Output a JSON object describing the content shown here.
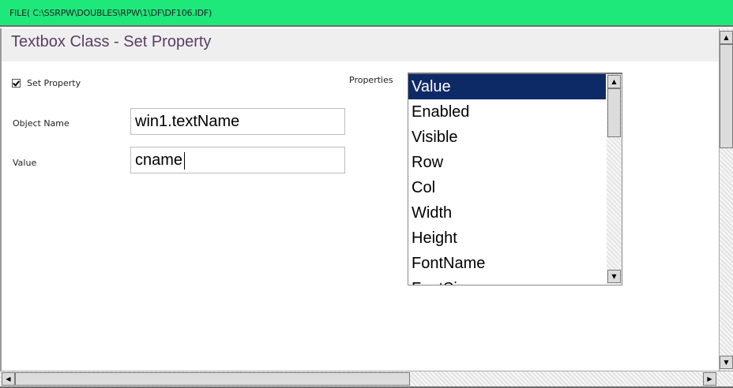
{
  "file_bar": {
    "path": "FILE( C:\\SSRPW\\DOUBLES\\RPW\\1\\DF\\DF106.IDF)"
  },
  "form": {
    "title": "Textbox Class - Set Property",
    "set_property_label": "Set Property",
    "set_property_checked": true,
    "object_name_label": "Object Name",
    "object_name_value": "win1.textName",
    "value_label": "Value",
    "value_value": "cname",
    "properties_label": "Properties"
  },
  "properties_list": {
    "selected": "Value",
    "items": [
      "Value",
      "Enabled",
      "Visible",
      "Row",
      "Col",
      "Width",
      "Height",
      "FontName",
      "FontSize"
    ]
  },
  "icons": {
    "scroll_up": "scroll-up-arrow-icon",
    "scroll_down": "scroll-down-arrow-icon",
    "scroll_left": "scroll-left-arrow-icon",
    "scroll_right": "scroll-right-arrow-icon",
    "checkbox": "checkmark-icon"
  },
  "colors": {
    "file_bar_bg": "#1ee87a",
    "title_color": "#5a3e63",
    "selection_bg": "#0e2a66"
  }
}
